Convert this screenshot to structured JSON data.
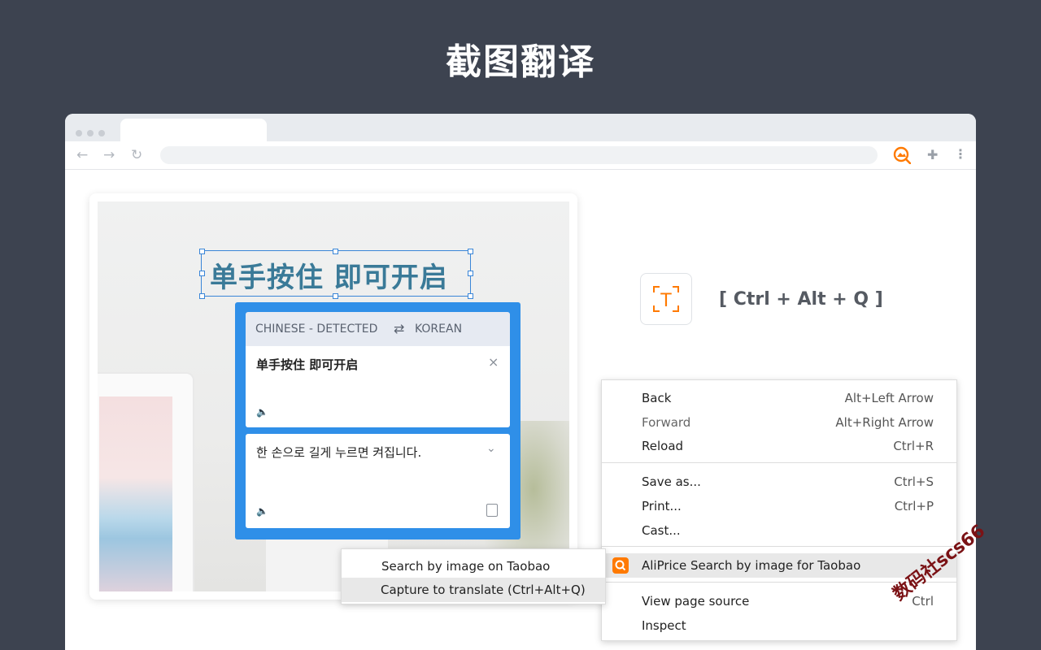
{
  "headline": "截图翻译",
  "browser": {
    "nav": {
      "back": "←",
      "forward": "→",
      "reload": "↻"
    },
    "icons": [
      "aliprice-extension-icon",
      "puzzle-icon",
      "kebab-menu-icon"
    ]
  },
  "selection": {
    "text": "单手按住 即可开启"
  },
  "translator": {
    "source_lang": "CHINESE - DETECTED",
    "swap": "⇄",
    "target_lang": "KOREAN",
    "source_text": "单手按住 即可开启",
    "close": "×",
    "translated_text": "한 손으로 길게 누르면 켜집니다.",
    "expand": "⌄"
  },
  "hotkey": {
    "tile_letter": "T",
    "text": "[ Ctrl + Alt + Q ]"
  },
  "context_menu": {
    "items": [
      {
        "label": "Back",
        "shortcut": "Alt+Left Arrow"
      },
      {
        "label": "Forward",
        "shortcut": "Alt+Right Arrow"
      },
      {
        "label": "Reload",
        "shortcut": "Ctrl+R"
      },
      {
        "label": "Save as...",
        "shortcut": "Ctrl+S"
      },
      {
        "label": "Print...",
        "shortcut": "Ctrl+P"
      },
      {
        "label": "Cast..."
      },
      {
        "label": "AliPrice Search by image for Taobao"
      },
      {
        "label": "View page source",
        "shortcut": "Ctrl"
      },
      {
        "label": "Inspect"
      }
    ]
  },
  "submenu": {
    "items": [
      {
        "label": "Search by image on Taobao"
      },
      {
        "label": "Capture to translate (Ctrl+Alt+Q)"
      }
    ]
  },
  "watermark": "数码社scs66",
  "colors": {
    "background": "#3d4350",
    "accent": "#2f8fe8",
    "orange": "#ff7a00"
  }
}
